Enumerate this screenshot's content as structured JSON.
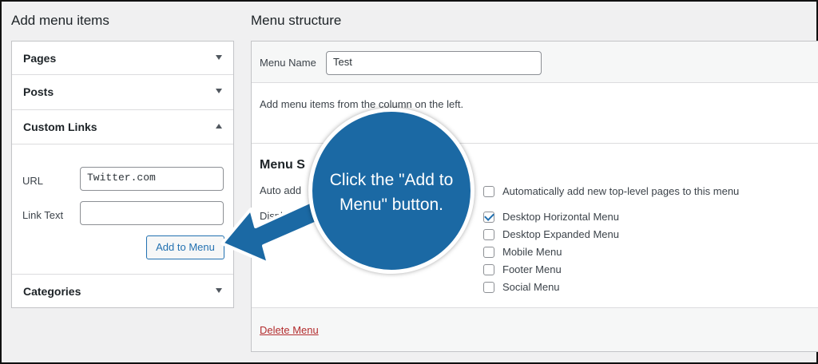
{
  "left": {
    "heading": "Add menu items",
    "accordion": {
      "pages": "Pages",
      "posts": "Posts",
      "custom_links": "Custom Links",
      "categories": "Categories"
    },
    "custom_links": {
      "url_label": "URL",
      "url_value": "Twitter.com",
      "link_text_label": "Link Text",
      "link_text_value": "",
      "add_button": "Add to Menu"
    }
  },
  "right": {
    "heading": "Menu structure",
    "menu_name_label": "Menu Name",
    "menu_name_value": "Test",
    "instructions": "Add menu items from the column on the left.",
    "settings_heading": "Menu S",
    "auto_add_label": "Auto add",
    "display_label": "Displ",
    "auto_add_option": {
      "label": "Automatically add new top-level pages to this menu",
      "checked": false
    },
    "locations": [
      {
        "label": "Desktop Horizontal Menu",
        "checked": true
      },
      {
        "label": "Desktop Expanded Menu",
        "checked": false
      },
      {
        "label": "Mobile Menu",
        "checked": false
      },
      {
        "label": "Footer Menu",
        "checked": false
      },
      {
        "label": "Social Menu",
        "checked": false
      }
    ],
    "delete_link": "Delete Menu"
  },
  "callout": {
    "line1": "Click the \"Add to",
    "line2": "Menu\" button.",
    "color": "#1b69a4"
  },
  "colors": {
    "accent": "#2271b1",
    "delete": "#b32d2e"
  }
}
